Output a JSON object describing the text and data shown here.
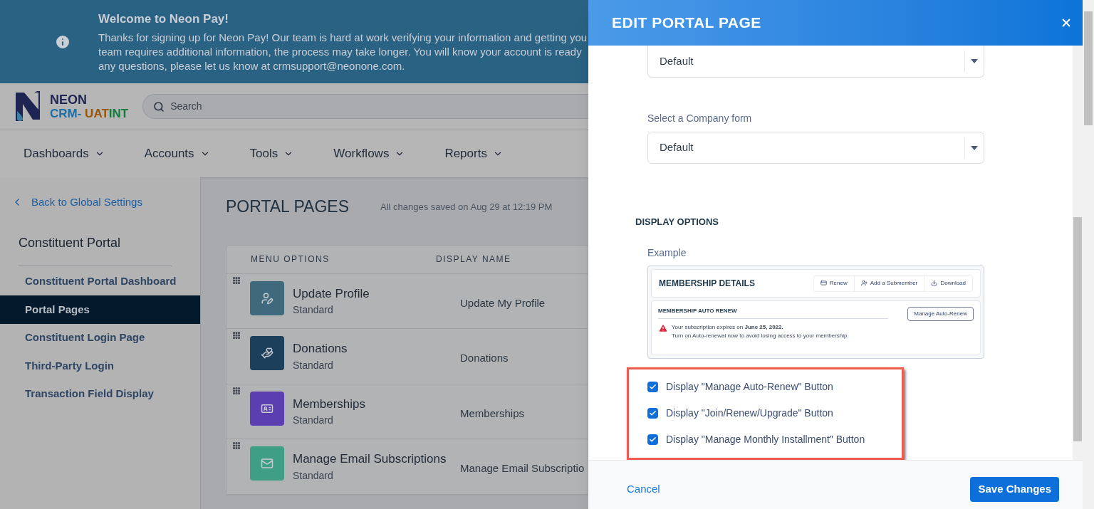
{
  "banner": {
    "title": "Welcome to Neon Pay!",
    "lines": [
      "Thanks for signing up for Neon Pay! Our team is hard at work verifying your information and getting you",
      "team requires additional information, the process may take longer. You will know your account is ready",
      "any questions, please let us know at crmsupport@neonone.com."
    ]
  },
  "logo": {
    "name": "NEON",
    "parts": [
      {
        "text": "CRM- ",
        "color": "#1a6fa6"
      },
      {
        "text": "UAT",
        "color": "#9a5608"
      },
      {
        "text": "INT",
        "color": "#157a3e"
      }
    ]
  },
  "search": {
    "placeholder": "Search"
  },
  "nav": [
    "Dashboards",
    "Accounts",
    "Tools",
    "Workflows",
    "Reports"
  ],
  "sidebar": {
    "back": "Back to Global Settings",
    "title": "Constituent Portal",
    "items": [
      {
        "label": "Constituent Portal Dashboard",
        "selected": false
      },
      {
        "label": "Portal Pages",
        "selected": true
      },
      {
        "label": "Constituent Login Page",
        "selected": false
      },
      {
        "label": "Third-Party Login",
        "selected": false
      },
      {
        "label": "Transaction Field Display",
        "selected": false
      }
    ]
  },
  "main": {
    "title": "PORTAL PAGES",
    "status": "All changes saved on Aug 29 at 12:19 PM",
    "table": {
      "columns": [
        "MENU OPTIONS",
        "DISPLAY NAME"
      ],
      "rows": [
        {
          "name": "Update Profile",
          "type": "Standard",
          "display_name": "Update My Profile",
          "kind": "profile",
          "color": "#3f6a7e"
        },
        {
          "name": "Donations",
          "type": "Standard",
          "display_name": "Donations",
          "kind": "donation",
          "color": "#1c3f5c"
        },
        {
          "name": "Memberships",
          "type": "Standard",
          "display_name": "Memberships",
          "kind": "membership",
          "color": "#5b3fb0"
        },
        {
          "name": "Manage Email Subscriptions",
          "type": "Standard",
          "display_name": "Manage Email Subscriptio",
          "kind": "email",
          "color": "#3f9e86"
        }
      ]
    }
  },
  "panel": {
    "title": "EDIT PORTAL PAGE",
    "fields": [
      {
        "value": "Default"
      },
      {
        "label": "Select a Company form",
        "value": "Default"
      }
    ],
    "section": "DISPLAY OPTIONS",
    "example_label": "Example",
    "example": {
      "title": "MEMBERSHIP DETAILS",
      "actions": [
        "Renew",
        "Add a Submember",
        "Download"
      ],
      "card_title": "MEMBERSHIP AUTO RENEW",
      "card_button": "Manage Auto-Renew",
      "message": "Your subscription expires on **June 25, 2022.**",
      "message_2": "Turn on Auto-renewal now to avoid losing access to your membership."
    },
    "options": [
      {
        "label": "Display \"Manage Auto-Renew\" Button",
        "checked": true
      },
      {
        "label": "Display \"Join/Renew/Upgrade\" Button",
        "checked": true
      },
      {
        "label": "Display \"Manage Monthly Installment\" Button",
        "checked": true
      }
    ],
    "cancel": "Cancel",
    "save": "Save Changes"
  }
}
